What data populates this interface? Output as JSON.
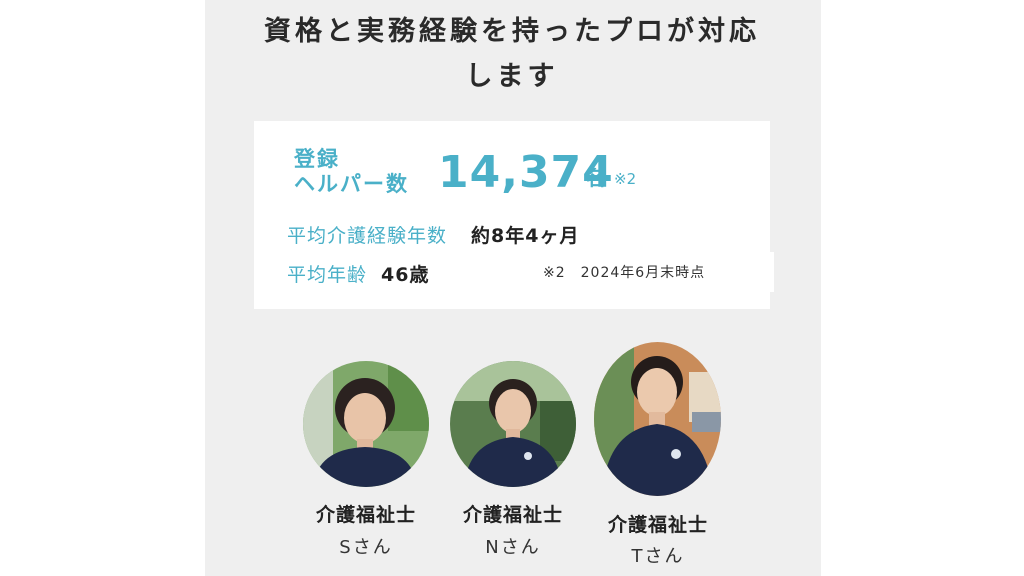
{
  "headline": {
    "line1": "資格と実務経験を持ったプロが対応",
    "line2": "します"
  },
  "stats": {
    "registered_label_line1": "登録",
    "registered_label_line2": "ヘルパー数",
    "registered_count": "14,374",
    "registered_unit": "名",
    "registered_note_mark": "※2",
    "experience_label": "平均介護経験年数",
    "experience_value": "約8年4ヶ月",
    "age_label": "平均年齢",
    "age_value": "46歳",
    "footnote": "※2　2024年6月末時点"
  },
  "staff": [
    {
      "title": "介護福祉士",
      "name": "Sさん"
    },
    {
      "title": "介護福祉士",
      "name": "Nさん"
    },
    {
      "title": "介護福祉士",
      "name": "Tさん"
    }
  ],
  "colors": {
    "accent": "#4ab0c8",
    "panel_bg": "#efefef",
    "card_bg": "#ffffff",
    "text_dark": "#222222",
    "uniform_navy": "#1f2a4a"
  },
  "icons": [
    "staff-photo-s",
    "staff-photo-n",
    "staff-photo-t"
  ]
}
